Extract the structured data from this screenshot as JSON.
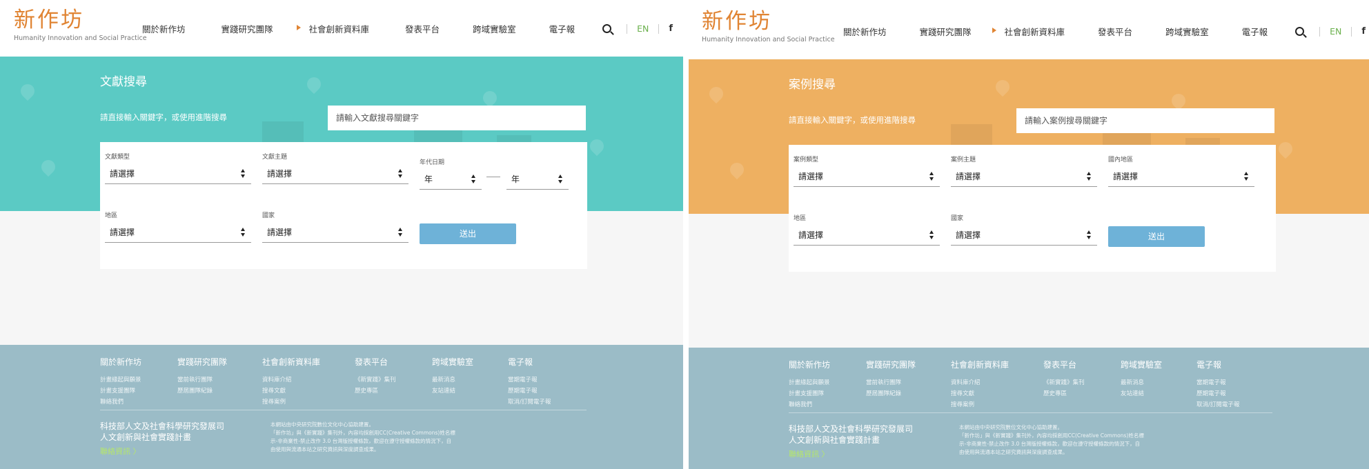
{
  "logo": {
    "mark": "新作坊",
    "tagline": "Humanity Innovation and Social Practice",
    "color": "#e08433"
  },
  "nav": {
    "items": [
      "關於新作坊",
      "實踐研究團隊",
      "社會創新資料庫",
      "發表平台",
      "跨域實驗室",
      "電子報"
    ],
    "active_index": 2,
    "lang": "EN",
    "facebook": "f"
  },
  "screens": [
    {
      "accent": "#5bcac4",
      "hero": {
        "title": "文獻搜尋",
        "hint": "請直接輸入關鍵字，或使用進階搜尋",
        "search_placeholder": "請輸入文獻搜尋關鍵字"
      },
      "form": {
        "field_a_label": "文獻類型",
        "field_b_label": "文獻主題",
        "field_c_label": "年代日期",
        "year_from": "年",
        "year_to": "年",
        "region_label": "地區",
        "country_label": "國家",
        "select_value": "請選擇",
        "submit": "送出"
      }
    },
    {
      "accent": "#eeb061",
      "hero": {
        "title": "案例搜尋",
        "hint": "請直接輸入關鍵字，或使用進階搜尋",
        "search_placeholder": "請輸入案例搜尋關鍵字"
      },
      "form": {
        "field_a_label": "案例類型",
        "field_b_label": "案例主題",
        "field_c_label": "國內地區",
        "region_label": "地區",
        "country_label": "國家",
        "select_value": "請選擇",
        "submit": "送出"
      }
    }
  ],
  "footer": {
    "columns": [
      {
        "heading": "關於新作坊",
        "links": [
          "計畫緣起與願景",
          "計畫支援團隊",
          "聯絡我們"
        ]
      },
      {
        "heading": "實踐研究團隊",
        "links": [
          "當前執行團隊",
          "歷屆團隊紀錄"
        ]
      },
      {
        "heading": "社會創新資料庫",
        "links": [
          "資料庫介紹",
          "搜尋文獻",
          "搜尋案例"
        ]
      },
      {
        "heading": "發表平台",
        "links": [
          "《新實踐》集刊",
          "歷史專區"
        ]
      },
      {
        "heading": "跨域實驗室",
        "links": [
          "最新消息",
          "友站連結"
        ]
      },
      {
        "heading": "電子報",
        "links": [
          "當期電子報",
          "歷期電子報",
          "取消/訂閱電子報"
        ]
      }
    ],
    "org_line1": "科技部人文及社會科學研究發展司",
    "org_line2": "人文創新與社會實踐計畫",
    "contact": "聯絡資訊 〉",
    "note_line1": "本網站由中央研究院數位文化中心協助建置。",
    "note_line2": "「新作坊」與《新實踐》集刊外，內容均採創用CC(Creative Commons)姓名標",
    "note_line3": "示-非商業性-禁止改作 3.0 台灣版授權條款，歡迎在遵守授權條款的情況下，自",
    "note_line4": "由使用與流通本站之研究資訊與深度調查成果。",
    "bg": "#9bbcc7"
  }
}
